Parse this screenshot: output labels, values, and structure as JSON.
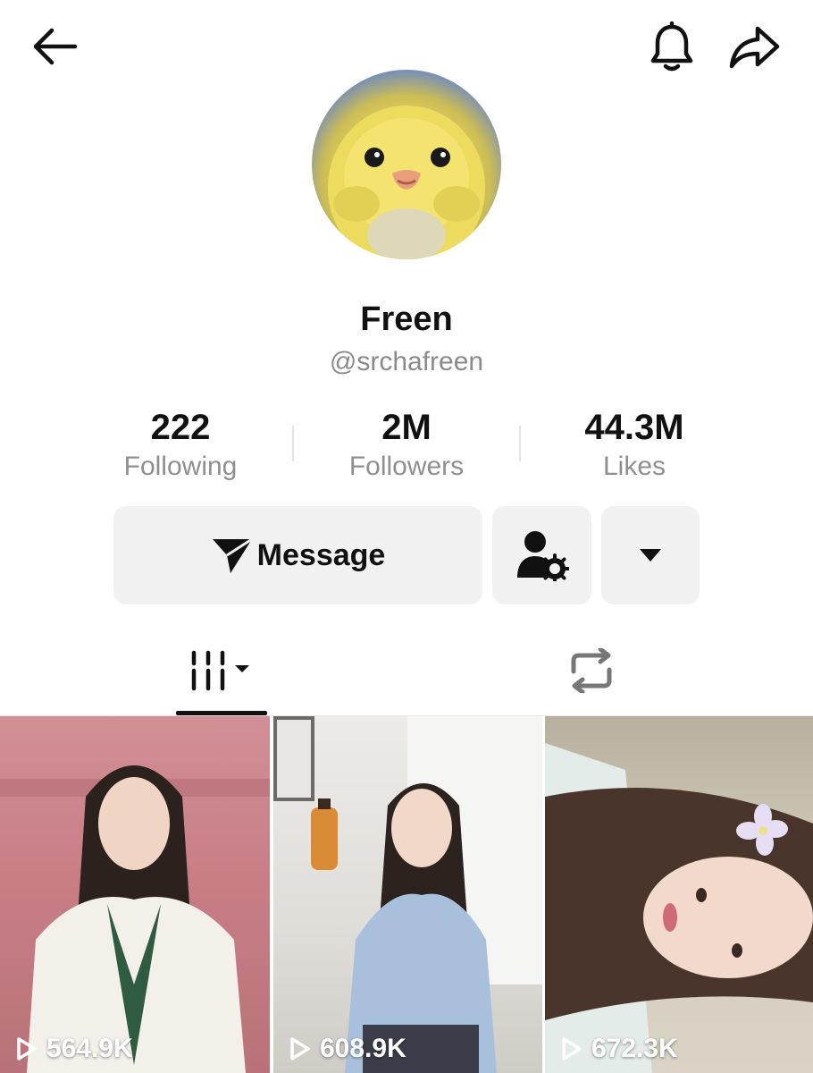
{
  "profile": {
    "name": "Freen",
    "handle": "@srchafreen"
  },
  "stats": {
    "following": {
      "value": "222",
      "label": "Following"
    },
    "followers": {
      "value": "2M",
      "label": "Followers"
    },
    "likes": {
      "value": "44.3M",
      "label": "Likes"
    }
  },
  "actions": {
    "message_label": "Message"
  },
  "icons": {
    "back": "arrow-left-icon",
    "bell": "bell-icon",
    "share": "share-arrow-icon",
    "message": "send-icon",
    "friend": "user-settings-icon",
    "more": "caret-down-icon",
    "videos_tab": "grid-columns-icon",
    "reposts_tab": "repost-icon",
    "play": "play-outline-icon"
  },
  "videos": [
    {
      "views": "564.9K"
    },
    {
      "views": "608.9K"
    },
    {
      "views": "672.3K"
    }
  ],
  "colors": {
    "button_bg": "#f1f1f1",
    "secondary_text": "#8a8a8a"
  }
}
